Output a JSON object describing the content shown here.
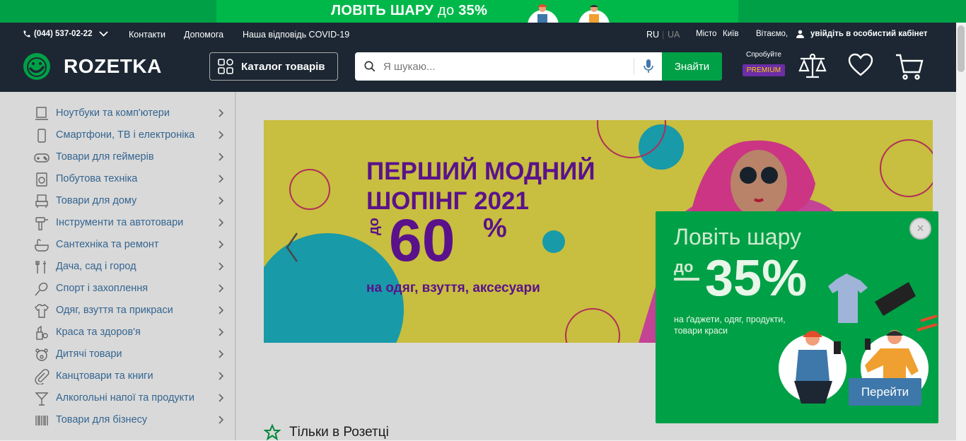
{
  "promo": {
    "text_main": "ЛОВІТЬ ШАРУ",
    "text_do": "до",
    "text_pct": "35%"
  },
  "topline": {
    "phone": "(044) 537-02-22",
    "links": [
      "Контакти",
      "Допомога",
      "Наша відповідь COVID-19"
    ],
    "lang_ru": "RU",
    "lang_ua": "UA",
    "city_label": "Місто",
    "city": "Київ",
    "greeting": "Вітаємо,",
    "login": "увійдіть в особистий кабінет"
  },
  "header": {
    "logo": "ROZETKA",
    "catalog": "Каталог товарів",
    "search_placeholder": "Я шукаю...",
    "search_button": "Знайти",
    "premium_try": "Спробуйте",
    "premium": "PREMIUM"
  },
  "sidebar": {
    "items": [
      {
        "label": "Ноутбуки та комп'ютери",
        "icon": "laptop-icon"
      },
      {
        "label": "Смартфони, ТВ і електроніка",
        "icon": "smartphone-icon"
      },
      {
        "label": "Товари для геймерів",
        "icon": "gamepad-icon"
      },
      {
        "label": "Побутова техніка",
        "icon": "washer-icon"
      },
      {
        "label": "Товари для дому",
        "icon": "armchair-icon"
      },
      {
        "label": "Інструменти та автотовари",
        "icon": "drill-icon"
      },
      {
        "label": "Сантехніка та ремонт",
        "icon": "bath-icon"
      },
      {
        "label": "Дача, сад і город",
        "icon": "garden-icon"
      },
      {
        "label": "Спорт і захоплення",
        "icon": "racket-icon"
      },
      {
        "label": "Одяг, взуття та прикраси",
        "icon": "shirt-icon"
      },
      {
        "label": "Краса та здоров'я",
        "icon": "cosmetics-icon"
      },
      {
        "label": "Дитячі товари",
        "icon": "teddy-bear-icon"
      },
      {
        "label": "Канцтовари та книги",
        "icon": "paperclip-icon"
      },
      {
        "label": "Алкогольні напої та продукти",
        "icon": "cocktail-icon"
      },
      {
        "label": "Товари для бізнесу",
        "icon": "barcode-icon"
      }
    ]
  },
  "banner": {
    "title": "ПЕРШИЙ МОДНИЙ\nШОПІНГ 2021",
    "do": "до",
    "value": "60",
    "pct": "%",
    "subtitle": "на одяг, взуття, аксесуари"
  },
  "section": {
    "only_title": "Тільки в Розетці"
  },
  "popup": {
    "title": "Ловіть шару",
    "do": "до",
    "value": "35%",
    "subtitle": "на ґаджети, одяг, продукти,\nтовари краси",
    "button": "Перейти",
    "close": "×"
  },
  "colors": {
    "brand_green": "#00a046",
    "header_bg": "#1c2733",
    "link_blue": "#3e77aa",
    "banner_purple": "#6a16a3",
    "banner_yellow": "#ece04b"
  }
}
